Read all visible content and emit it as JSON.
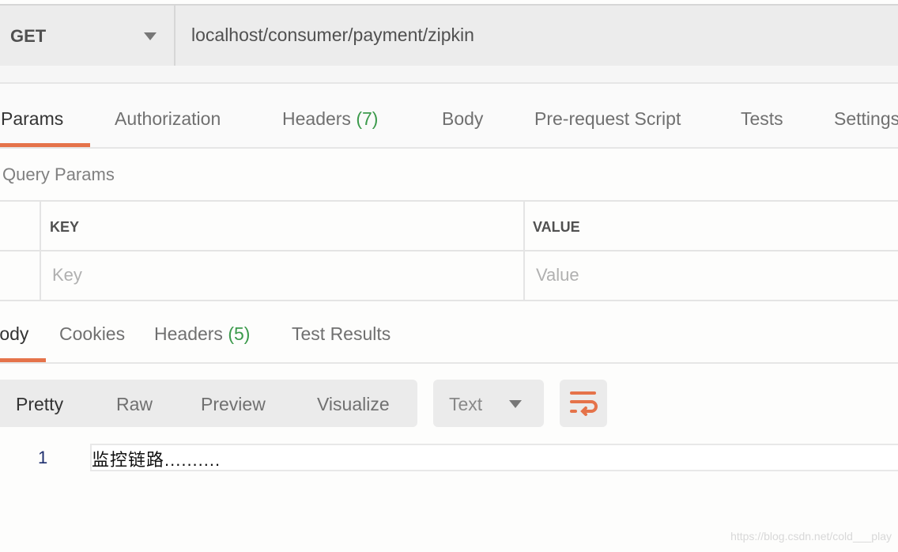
{
  "request": {
    "method": "GET",
    "url": "localhost/consumer/payment/zipkin"
  },
  "request_tabs": [
    {
      "label": "Params",
      "active": true
    },
    {
      "label": "Authorization"
    },
    {
      "label": "Headers",
      "count": "(7)"
    },
    {
      "label": "Body"
    },
    {
      "label": "Pre-request Script"
    },
    {
      "label": "Tests"
    },
    {
      "label": "Settings"
    }
  ],
  "query_params": {
    "title": "Query Params",
    "key_header": "KEY",
    "value_header": "VALUE",
    "key_placeholder": "Key",
    "value_placeholder": "Value"
  },
  "response_tabs": [
    {
      "label": "Body",
      "active": true
    },
    {
      "label": "Cookies"
    },
    {
      "label": "Headers",
      "count": "(5)"
    },
    {
      "label": "Test Results"
    }
  ],
  "view_modes": [
    "Pretty",
    "Raw",
    "Preview",
    "Visualize"
  ],
  "format": "Text",
  "response_body": {
    "line_number": "1",
    "content": "监控链路.........."
  },
  "watermark": "https://blog.csdn.net/cold___play",
  "colors": {
    "accent": "#e5734a",
    "count": "#3c9a4c"
  }
}
